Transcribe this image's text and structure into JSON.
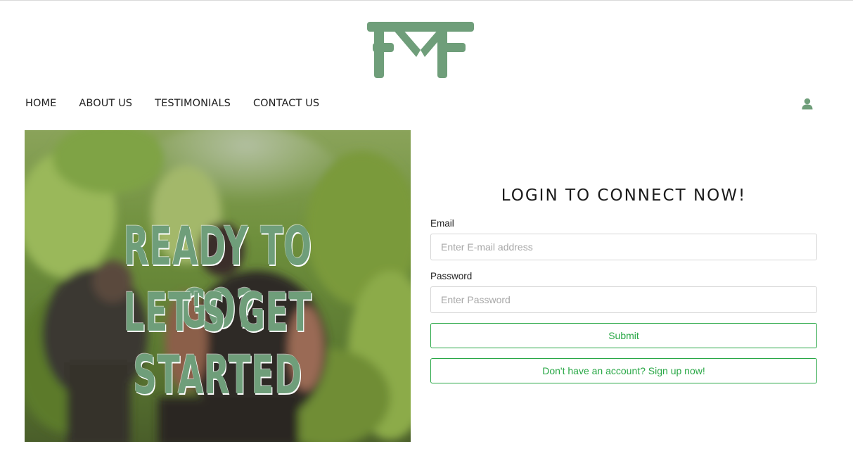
{
  "brand": {
    "logo_text": "FMF",
    "logo_color": "#6f9e7a"
  },
  "nav": {
    "items": [
      {
        "label": "HOME"
      },
      {
        "label": "ABOUT US"
      },
      {
        "label": "TESTIMONIALS"
      },
      {
        "label": "CONTACT US"
      }
    ],
    "user_icon": "user-icon"
  },
  "hero": {
    "line1": "READY TO GO?",
    "line2": "LET'S GET STARTED"
  },
  "login": {
    "title": "LOGIN TO CONNECT NOW!",
    "email_label": "Email",
    "email_placeholder": "Enter E-mail address",
    "email_value": "",
    "password_label": "Password",
    "password_placeholder": "Enter Password",
    "password_value": "",
    "submit_label": "Submit",
    "signup_label": "Don't have an account? Sign up now!"
  },
  "colors": {
    "accent": "#28a745",
    "brand_green": "#6f9e7a"
  }
}
